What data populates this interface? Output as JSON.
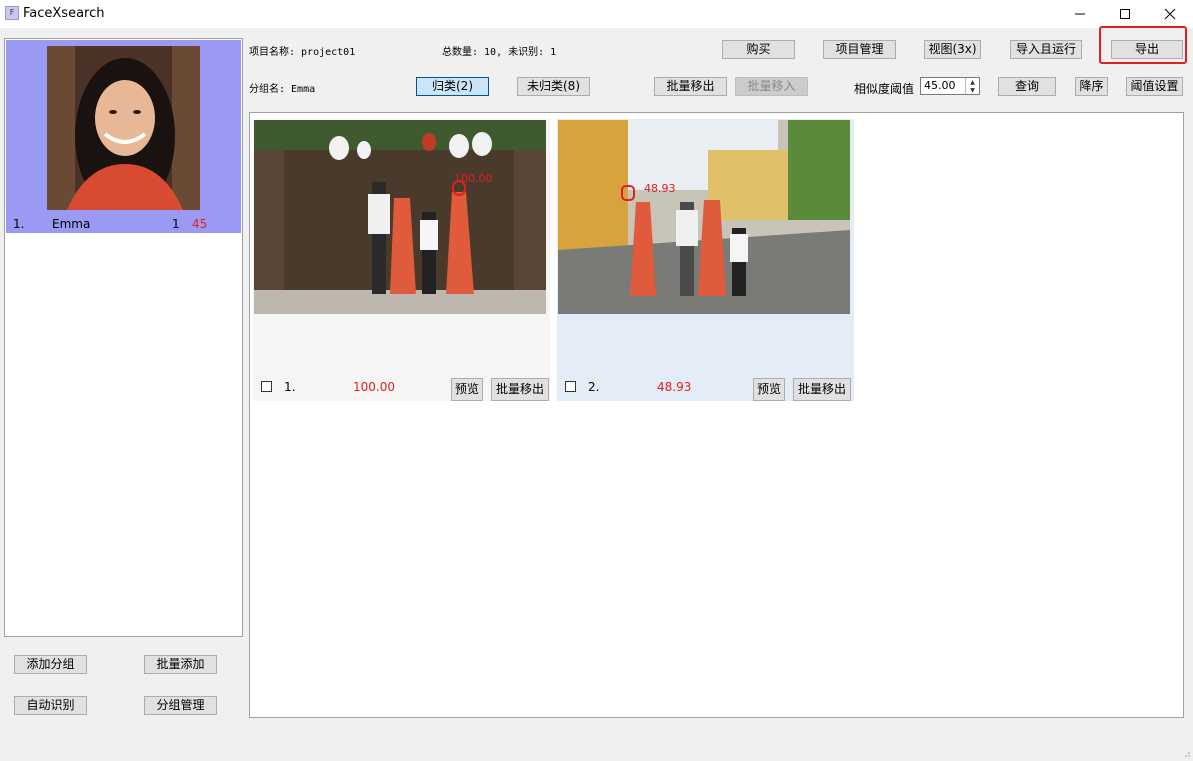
{
  "window": {
    "title": "FaceXsearch",
    "icon_letter": "F"
  },
  "header": {
    "project_label": "项目名称: project01",
    "total_label": "总数量: 10, 未识别: 1",
    "group_label": "分组名: Emma",
    "similarity_label": "相似度阈值",
    "similarity_value": "45.00"
  },
  "toolbar": {
    "buy": "购买",
    "project_manage": "项目管理",
    "view": "视图(3x)",
    "import_run": "导入且运行",
    "export": "导出",
    "classified": "归类(2)",
    "unclassified": "未归类(8)",
    "batch_move_out": "批量移出",
    "batch_move_in": "批量移入",
    "query": "查询",
    "sort_desc": "降序",
    "threshold_settings": "阈值设置"
  },
  "groups": [
    {
      "index": "1.",
      "name": "Emma",
      "count": "1",
      "score": "45"
    }
  ],
  "left_buttons": {
    "add_group": "添加分组",
    "batch_add": "批量添加",
    "auto_recognize": "自动识别",
    "group_manage": "分组管理"
  },
  "results": [
    {
      "index": "1.",
      "score": "100.00",
      "face_score": "100.00",
      "preview": "预览",
      "move_out": "批量移出"
    },
    {
      "index": "2.",
      "score": "48.93",
      "face_score": "48.93",
      "preview": "预览",
      "move_out": "批量移出"
    }
  ],
  "colors": {
    "accent": "#e02020",
    "selected_group": "#9a9af4",
    "card1_bg": "#f5f5f5",
    "card2_bg": "#e3ecf7"
  }
}
